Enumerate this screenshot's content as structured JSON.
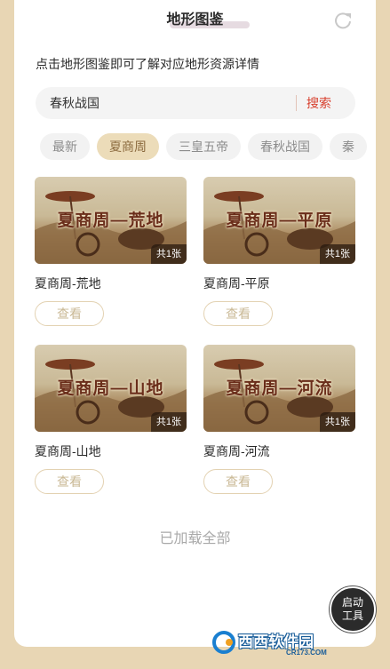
{
  "header": {
    "title": "地形图鉴",
    "refresh_icon": "refresh-icon"
  },
  "subtitle": "点击地形图鉴即可了解对应地形资源详情",
  "search": {
    "value": "春秋战国",
    "button_label": "搜索"
  },
  "tabs": [
    {
      "label": "最新",
      "active": false
    },
    {
      "label": "夏商周",
      "active": true
    },
    {
      "label": "三皇五帝",
      "active": false
    },
    {
      "label": "春秋战国",
      "active": false
    },
    {
      "label": "秦",
      "active": false
    }
  ],
  "cards": [
    {
      "image_title": "夏商周—荒地",
      "count": "共1张",
      "name": "夏商周-荒地",
      "button": "查看"
    },
    {
      "image_title": "夏商周—平原",
      "count": "共1张",
      "name": "夏商周-平原",
      "button": "查看"
    },
    {
      "image_title": "夏商周—山地",
      "count": "共1张",
      "name": "夏商周-山地",
      "button": "查看"
    },
    {
      "image_title": "夏商周—河流",
      "count": "共1张",
      "name": "夏商周-河流",
      "button": "查看"
    }
  ],
  "footer": {
    "loaded_text": "已加载全部",
    "tool_button": "启动\n工具"
  },
  "watermark": {
    "text": "西西软件园",
    "sub": "CR173.COM"
  },
  "colors": {
    "background": "#e8d6b4",
    "accent_red": "#d8412f",
    "tab_active_bg": "#ecdcb9",
    "tab_active_text": "#8b6a3e"
  }
}
